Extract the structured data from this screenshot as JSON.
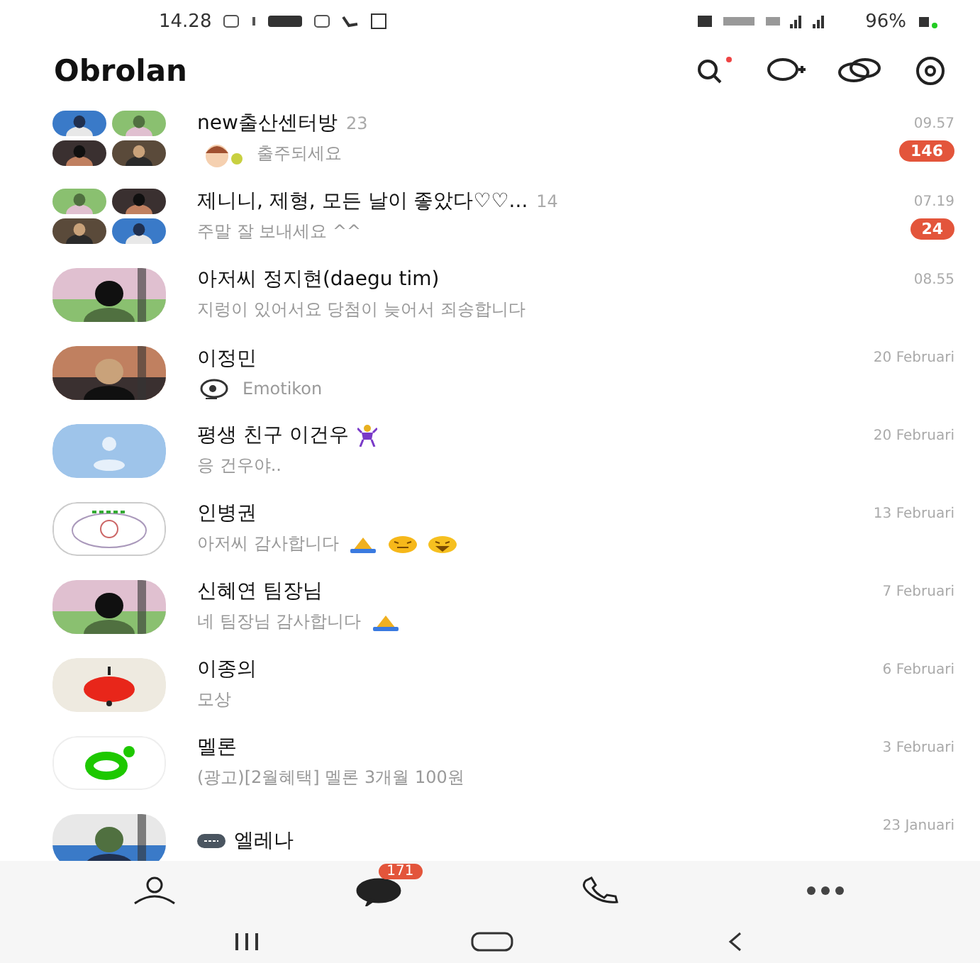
{
  "status_bar": {
    "time": "14.28",
    "battery": "96%"
  },
  "header": {
    "title": "Obrolan"
  },
  "chats": [
    {
      "kind": "group",
      "name": "new출산센터방",
      "members": "23",
      "preview": "출주되세요",
      "sticker": true,
      "time": "09.57",
      "unread": "146"
    },
    {
      "kind": "group",
      "name": "제니니, 제형, 모든 날이 좋았다♡♡...",
      "members": "14",
      "preview": "주말 잘 보내세요 ^^",
      "time": "07.19",
      "unread": "24"
    },
    {
      "name": "아저씨 정지현(daegu tim)",
      "preview": "지렁이 있어서요 당첨이 늦어서 죄송합니다",
      "time": "08.55"
    },
    {
      "name": "이정민",
      "preview": "Emotikon",
      "emoticon": true,
      "time": "20 Februari"
    },
    {
      "kind": "default",
      "name": "평생 친구 이건우",
      "name_emoji": [
        {
          "kind": "person"
        }
      ],
      "preview": "응 건우야..",
      "time": "20 Februari"
    },
    {
      "kind": "logo",
      "name": "인병권",
      "preview": "아저씨 감사합니다",
      "emoji": [
        {
          "kind": "pray"
        },
        {
          "kind": "laugh"
        },
        {
          "kind": "grin"
        }
      ],
      "time": "13 Februari"
    },
    {
      "name": "신혜연 팀장님",
      "preview": "네 팀장님 감사합니다",
      "emoji": [
        {
          "kind": "pray"
        }
      ],
      "time": "7 Februari"
    },
    {
      "kind": "lamp",
      "name": "이종의",
      "preview": "모상",
      "time": "6 Februari"
    },
    {
      "kind": "melon",
      "name": "멜론",
      "preview": "(광고)[2월혜택] 멜론 3개월 100원",
      "time": "3 Februari"
    },
    {
      "name": "엘레나",
      "tag": true,
      "time": "23 Januari"
    }
  ],
  "bottom_nav": [
    {
      "kind": "friends",
      "selected": false
    },
    {
      "kind": "chats",
      "selected": true,
      "badge": "171"
    },
    {
      "kind": "calls",
      "selected": false
    },
    {
      "kind": "more",
      "selected": false
    }
  ]
}
